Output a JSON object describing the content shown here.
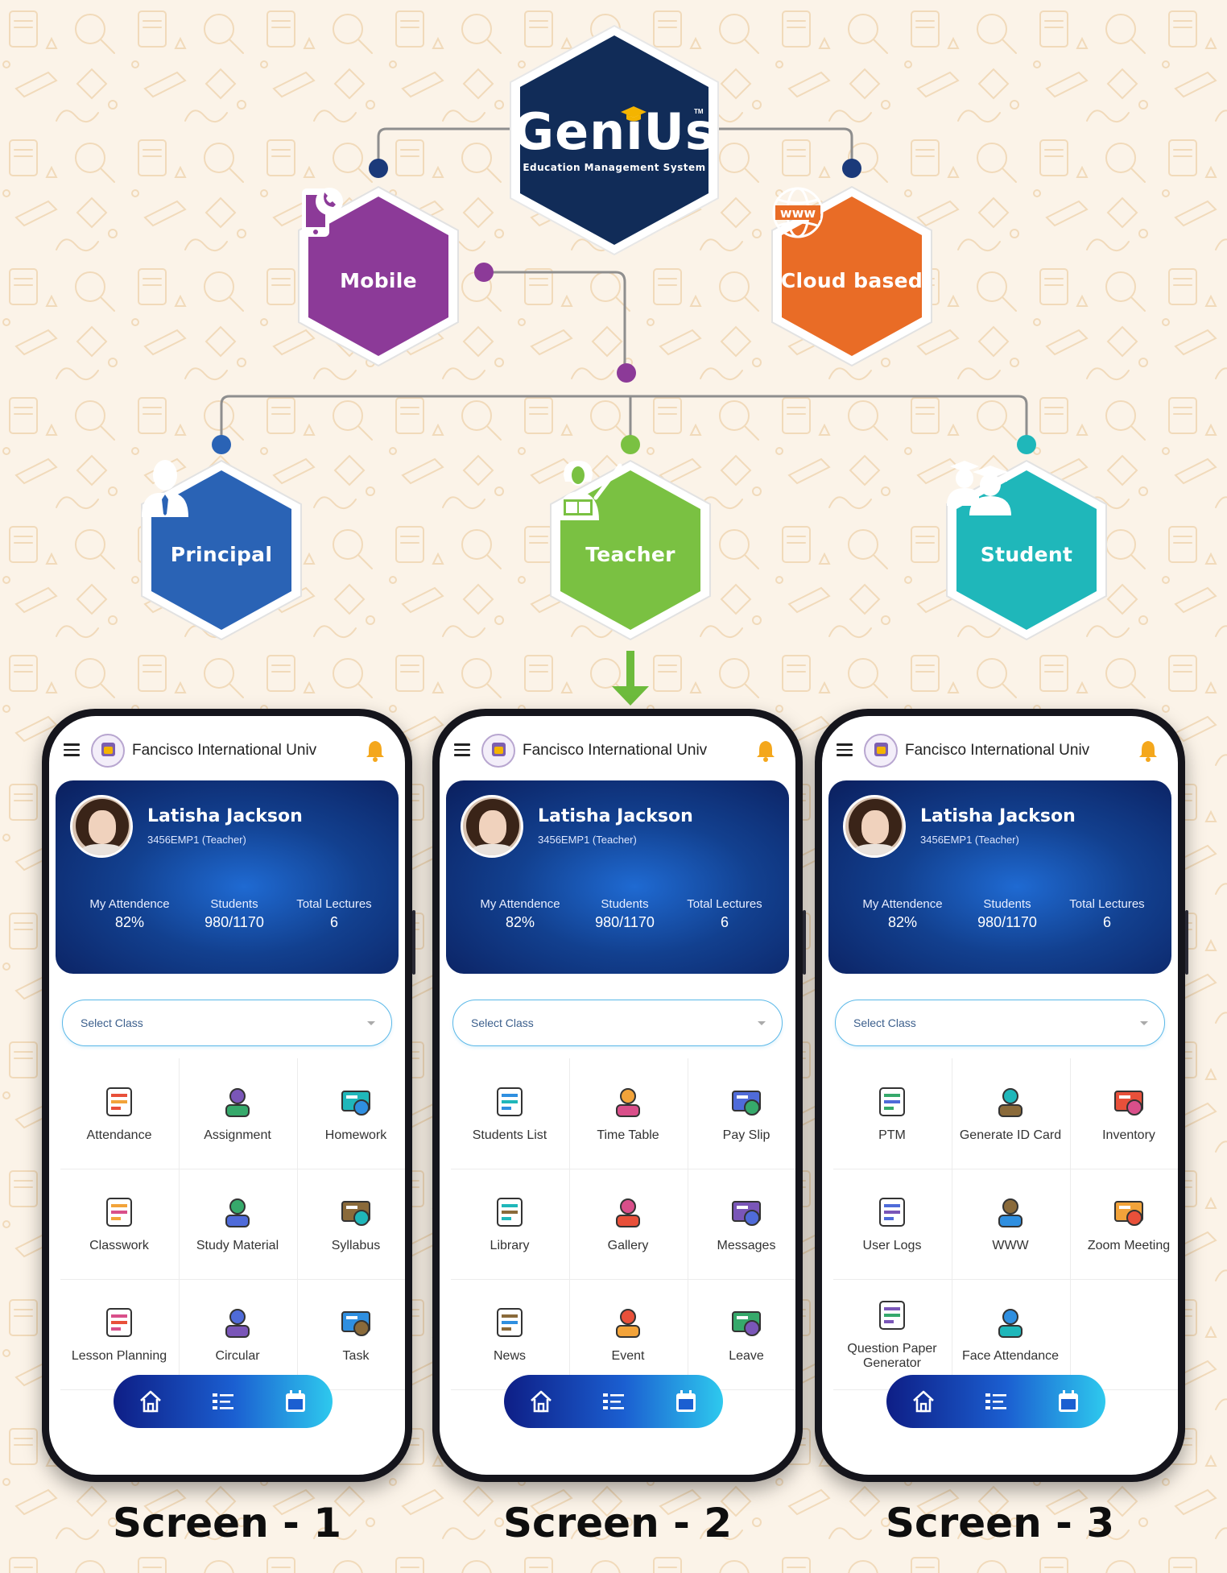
{
  "logo": {
    "name": "GeniUs",
    "tagline": "Education Management System",
    "tm": "TM"
  },
  "platforms": [
    {
      "label": "Mobile",
      "color": "#8c3a98",
      "icon": "phone-call-icon"
    },
    {
      "label": "Cloud based",
      "color": "#e96c26",
      "icon": "globe-www-icon"
    }
  ],
  "roles": [
    {
      "label": "Principal",
      "color": "#2a63b5",
      "icon": "person-tie-icon"
    },
    {
      "label": "Teacher",
      "color": "#7ac142",
      "icon": "teacher-pointer-icon"
    },
    {
      "label": "Student",
      "color": "#1fb7ba",
      "icon": "students-graduates-icon"
    }
  ],
  "connector_colors": {
    "mobile": "#8c3a98",
    "cloud": "#1b3a7a",
    "principal": "#2a63b5",
    "teacher": "#7ac142",
    "student": "#1fb7ba",
    "line": "#8c8c8c"
  },
  "app": {
    "university": "Fancisco International Univ",
    "teacher_name": "Latisha Jackson",
    "teacher_id": "3456EMP1 (Teacher)",
    "stats": [
      {
        "label": "My Attendence",
        "value": "82%"
      },
      {
        "label": "Students",
        "value": "980/1170"
      },
      {
        "label": "Total Lectures",
        "value": "6"
      }
    ],
    "select_placeholder": "Select Class",
    "nav_icons": [
      "home-icon",
      "list-icon",
      "calendar-icon"
    ]
  },
  "screens": [
    {
      "label": "Screen - 1",
      "items": [
        "Attendance",
        "Assignment",
        "Homework",
        "Classwork",
        "Study Material",
        "Syllabus",
        "Lesson Planning",
        "Circular",
        "Task"
      ]
    },
    {
      "label": "Screen - 2",
      "items": [
        "Students List",
        "Time Table",
        "Pay Slip",
        "Library",
        "Gallery",
        "Messages",
        "News",
        "Event",
        "Leave"
      ]
    },
    {
      "label": "Screen - 3",
      "items": [
        "PTM",
        "Generate ID Card",
        "Inventory",
        "User Logs",
        "WWW",
        "Zoom Meeting",
        "Question Paper Generator",
        "Face Attendance"
      ]
    }
  ]
}
